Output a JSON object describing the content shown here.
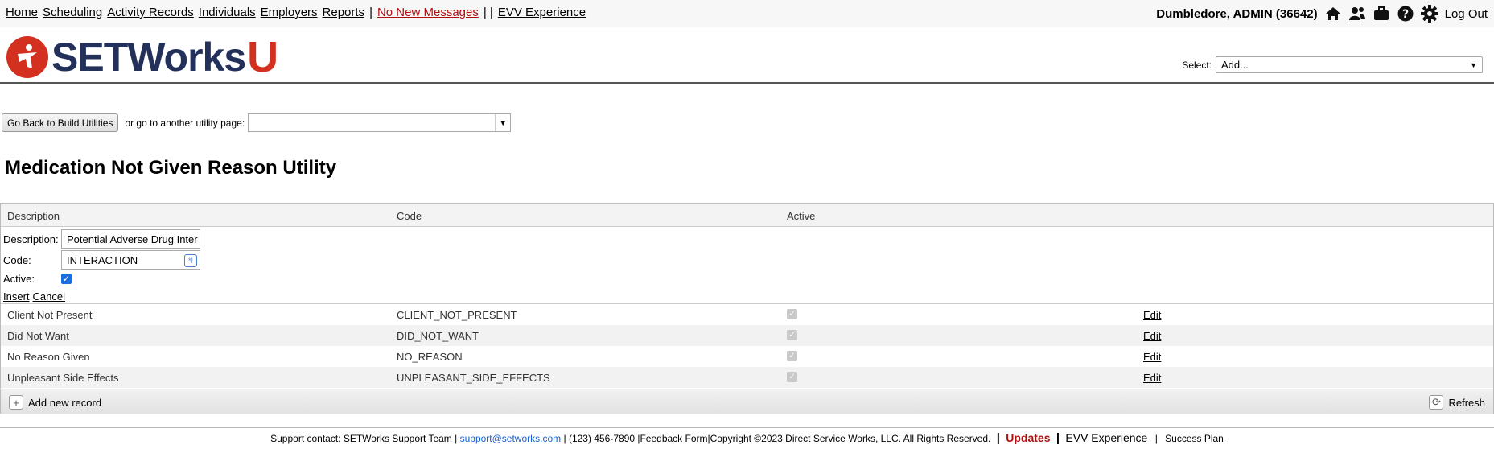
{
  "nav": {
    "links": [
      "Home",
      "Scheduling",
      "Activity Records",
      "Individuals",
      "Employers",
      "Reports"
    ],
    "separator": "|",
    "messages": "No New Messages",
    "double_sep": "| |",
    "evv": "EVV Experience"
  },
  "user": {
    "name": "Dumbledore, ADMIN",
    "id": "(36642)",
    "logout": "Log Out",
    "icons": [
      "home-icon",
      "users-icon",
      "briefcase-icon",
      "help-icon",
      "gear-icon"
    ]
  },
  "logo": {
    "main": "SETWorks",
    "accent": "U",
    "brand_red": "#d3301f",
    "brand_navy": "#23305a"
  },
  "header_select": {
    "label": "Select:",
    "value": "Add..."
  },
  "utility_nav": {
    "back_button": "Go Back to Build Utilities",
    "or_text": "or go to another utility page:",
    "select_value": ""
  },
  "page_title": "Medication Not Given Reason Utility",
  "grid": {
    "columns": [
      "Description",
      "Code",
      "Active"
    ],
    "form": {
      "description_label": "Description:",
      "description_value": "Potential Adverse Drug Inter",
      "code_label": "Code:",
      "code_value": "INTERACTION",
      "active_label": "Active:",
      "insert": "Insert",
      "cancel": "Cancel"
    },
    "rows": [
      {
        "description": "Client Not Present",
        "code": "CLIENT_NOT_PRESENT",
        "active": true,
        "edit": "Edit"
      },
      {
        "description": "Did Not Want",
        "code": "DID_NOT_WANT",
        "active": true,
        "edit": "Edit"
      },
      {
        "description": "No Reason Given",
        "code": "NO_REASON",
        "active": true,
        "edit": "Edit"
      },
      {
        "description": "Unpleasant Side Effects",
        "code": "UNPLEASANT_SIDE_EFFECTS",
        "active": true,
        "edit": "Edit"
      }
    ],
    "add_new": "Add new record",
    "refresh": "Refresh"
  },
  "footer": {
    "support": "Support contact: SETWorks Support Team |",
    "email": "support@setworks.com",
    "phone_copy": "| (123) 456-7890 |Feedback Form|Copyright ©2023 Direct Service Works, LLC. All Rights Reserved.",
    "bar": "|",
    "updates": "Updates",
    "evv": "EVV Experience",
    "success": "Success Plan"
  }
}
